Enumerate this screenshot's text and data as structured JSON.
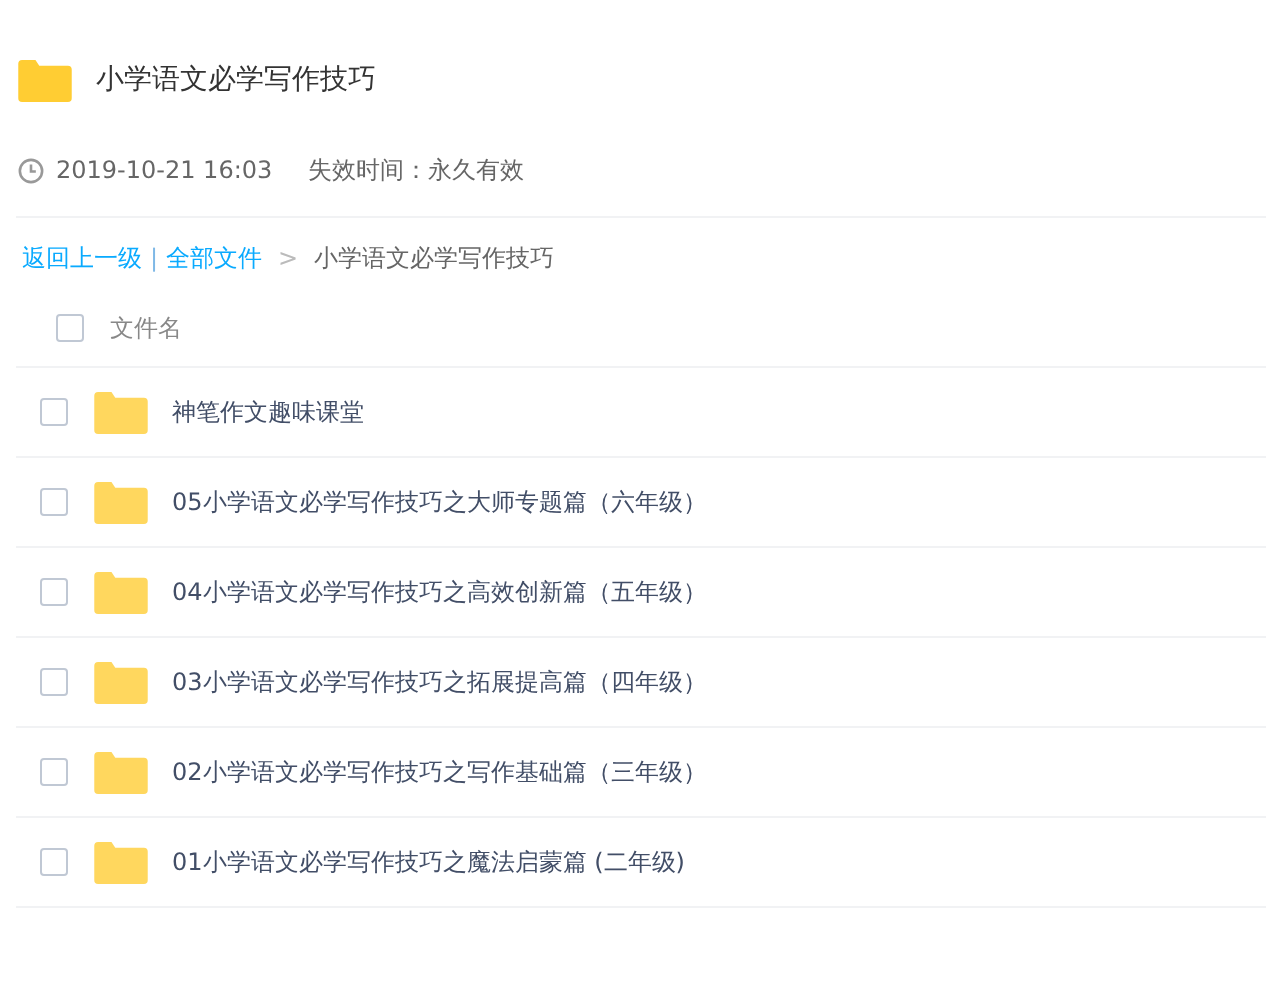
{
  "share": {
    "title": "小学语文必学写作技巧",
    "time": "2019-10-21 16:03",
    "expiry": "失效时间：永久有效"
  },
  "breadcrumb": {
    "back": "返回上一级",
    "divider": "|",
    "root": "全部文件",
    "arrow": ">",
    "current": "小学语文必学写作技巧"
  },
  "table": {
    "header": {
      "label": "文件名",
      "checked": false
    },
    "rows": [
      {
        "name": "神笔作文趣味课堂",
        "checked": false
      },
      {
        "name": "05小学语文必学写作技巧之大师专题篇（六年级）",
        "checked": false
      },
      {
        "name": "04小学语文必学写作技巧之高效创新篇（五年级）",
        "checked": false
      },
      {
        "name": "03小学语文必学写作技巧之拓展提高篇（四年级）",
        "checked": false
      },
      {
        "name": "02小学语文必学写作技巧之写作基础篇（三年级）",
        "checked": false
      },
      {
        "name": "01小学语文必学写作技巧之魔法启蒙篇 (二年级)",
        "checked": false
      }
    ]
  }
}
